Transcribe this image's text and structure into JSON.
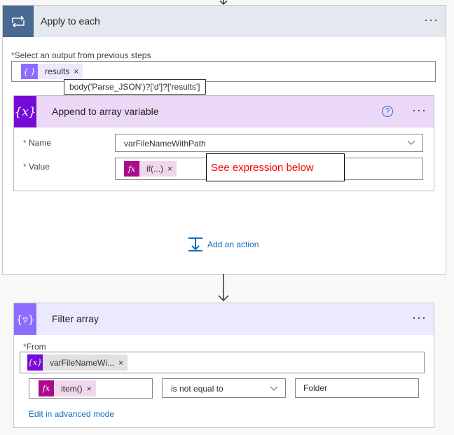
{
  "apply_each": {
    "title": "Apply to each",
    "more": "···",
    "select_label": "Select an output from previous steps",
    "token": "results",
    "token_remove": "×",
    "tooltip": "body('Parse_JSON')?['d']?['results']",
    "add_action": "Add an action"
  },
  "append": {
    "title": "Append to array variable",
    "help": "?",
    "more": "···",
    "name_label": "Name",
    "name_value": "varFileNameWithPath",
    "value_label": "Value",
    "value_token": "if(...)",
    "token_remove": "×",
    "annotation": "See expression below"
  },
  "filter": {
    "title": "Filter array",
    "more": "···",
    "from_label": "From",
    "from_token": "varFileNameWi...",
    "token_remove": "×",
    "left_token": "item()",
    "operator": "is not equal to",
    "right_value": "Folder",
    "advanced_link": "Edit in advanced mode"
  },
  "required_mark": "*",
  "colors": {
    "loop": "#486991",
    "variable": "#770bd6",
    "filter": "#8c6cff",
    "expression": "#ab0a8e",
    "link": "#0f6cbd",
    "annotation": "#ff0000"
  }
}
